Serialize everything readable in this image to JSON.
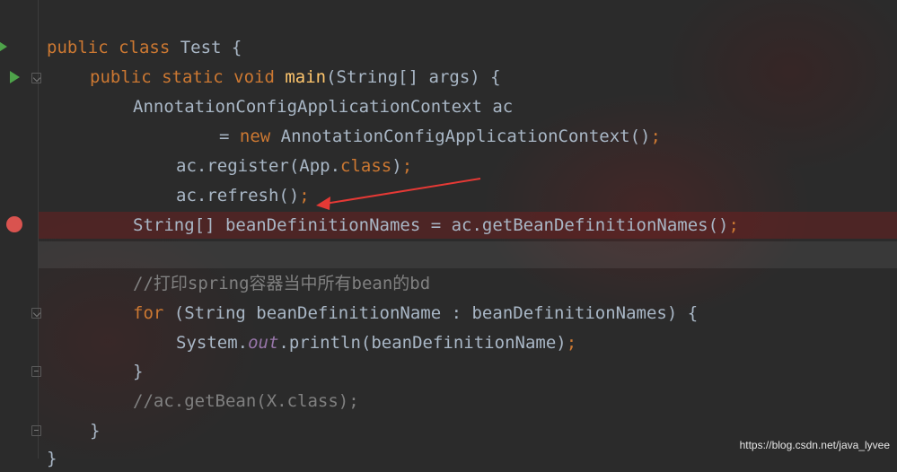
{
  "colors": {
    "keyword": "#cc7832",
    "text": "#a9b7c6",
    "method": "#ffc66d",
    "static_field": "#9876aa",
    "comment": "#808080",
    "breakpoint": "#d9534f",
    "run": "#4ea34a",
    "annotation_arrow": "#e53935"
  },
  "code": {
    "l1": {
      "kw": "public class ",
      "name": "Test {"
    },
    "l2": {
      "kw": "public static void ",
      "method": "main",
      "rest": "(String[] args) {"
    },
    "l3": {
      "text": "AnnotationConfigApplicationContext ac"
    },
    "l4": {
      "pre": "= ",
      "kw": "new ",
      "text": "AnnotationConfigApplicationContext()",
      "semi": ";"
    },
    "l5": {
      "pre": "ac.register(App.",
      "kw": "class",
      "post": ")",
      "semi": ";"
    },
    "l6": {
      "text": "ac.refresh()",
      "semi": ";"
    },
    "l7": {
      "text": "String[] beanDefinitionNames = ac.getBeanDefinitionNames()",
      "semi": ";"
    },
    "l9": {
      "comment": "//打印spring容器当中所有bean的bd"
    },
    "l10": {
      "kw": "for ",
      "text": "(String beanDefinitionName : beanDefinitionNames) {"
    },
    "l11": {
      "pre": "System.",
      "field": "out",
      "post": ".println(beanDefinitionName)",
      "semi": ";"
    },
    "l12": {
      "text": "}"
    },
    "l13": {
      "comment": "//ac.getBean(X.class);"
    },
    "l14": {
      "text": "}"
    },
    "l15": {
      "text": "}"
    }
  },
  "gutter": {
    "run_icon": "play-icon",
    "breakpoint_icon": "breakpoint-icon",
    "fold_icon": "fold-marker-icon"
  },
  "watermark": "https://blog.csdn.net/java_lyvee"
}
